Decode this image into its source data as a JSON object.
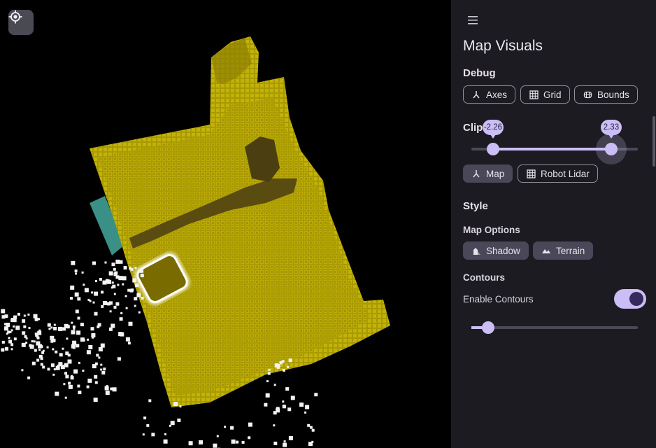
{
  "viewport": {
    "locate_icon": "crosshair-gps-icon"
  },
  "panel": {
    "menu_icon": "hamburger-menu-icon",
    "title": "Map Visuals",
    "debug": {
      "heading": "Debug",
      "axes_label": "Axes",
      "grid_label": "Grid",
      "bounds_label": "Bounds"
    },
    "clip": {
      "heading": "Clip",
      "min_value": "-2.26",
      "max_value": "2.33",
      "min_fraction": 0.13,
      "max_fraction": 0.84,
      "map_label": "Map",
      "robot_lidar_label": "Robot Lidar"
    },
    "style": {
      "heading": "Style",
      "map_options_heading": "Map Options",
      "shadow_label": "Shadow",
      "terrain_label": "Terrain",
      "contours_heading": "Contours",
      "enable_contours_label": "Enable Contours",
      "enable_contours_on": true,
      "contour_slider_fraction": 0.1
    }
  },
  "colors": {
    "accent": "#cbbdf5",
    "panel_bg": "#1c1b21",
    "map_yellow": "#b3a300",
    "teal": "#3a8f86"
  }
}
